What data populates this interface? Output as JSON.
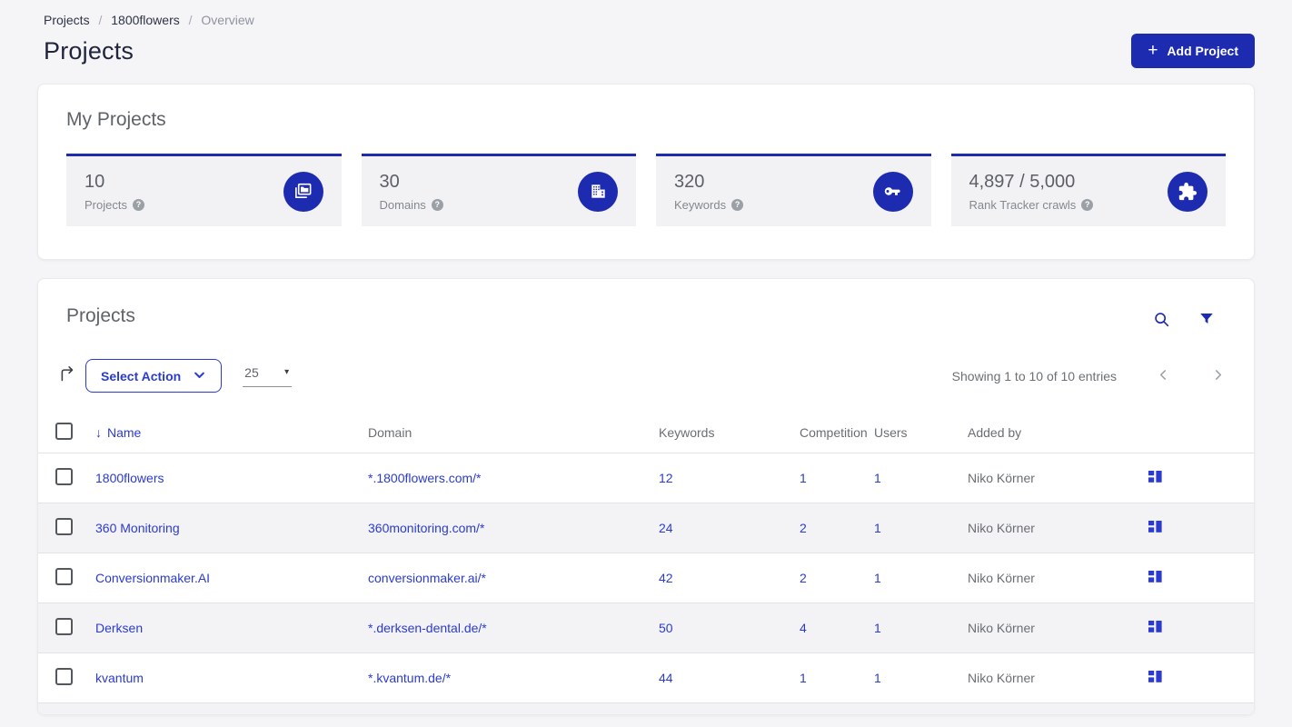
{
  "colors": {
    "primary": "#1d2bb1",
    "link": "#2b3bd0",
    "page_background": "#f5f5f7",
    "stripe": "#f3f3f5",
    "stat_background": "#f2f2f4"
  },
  "icons": {
    "help": "?",
    "plus": "+",
    "sort_desc": "↓",
    "caret": "▾"
  },
  "breadcrumb": {
    "separator": "/",
    "items": [
      "Projects",
      "1800flowers",
      "Overview"
    ]
  },
  "page": {
    "title": "Projects",
    "add_project_label": "Add Project"
  },
  "my_projects": {
    "title": "My Projects",
    "stats": [
      {
        "value": "10",
        "label": "Projects",
        "icon": "stacked-folders-icon"
      },
      {
        "value": "30",
        "label": "Domains",
        "icon": "building-icon"
      },
      {
        "value": "320",
        "label": "Keywords",
        "icon": "key-icon"
      },
      {
        "value": "4,897 / 5,000",
        "label": "Rank Tracker crawls",
        "icon": "puzzle-icon"
      }
    ]
  },
  "projects_table": {
    "title": "Projects",
    "select_action_label": "Select Action",
    "page_size": "25",
    "showing_text": "Showing 1 to 10 of 10 entries",
    "columns": {
      "name": "Name",
      "domain": "Domain",
      "keywords": "Keywords",
      "competition": "Competition",
      "users": "Users",
      "added_by": "Added by"
    },
    "rows": [
      {
        "name": "1800flowers",
        "domain": "*.1800flowers.com/*",
        "keywords": "12",
        "competition": "1",
        "users": "1",
        "added_by": "Niko Körner"
      },
      {
        "name": "360 Monitoring",
        "domain": "360monitoring.com/*",
        "keywords": "24",
        "competition": "2",
        "users": "1",
        "added_by": "Niko Körner"
      },
      {
        "name": "Conversionmaker.AI",
        "domain": "conversionmaker.ai/*",
        "keywords": "42",
        "competition": "2",
        "users": "1",
        "added_by": "Niko Körner"
      },
      {
        "name": "Derksen",
        "domain": "*.derksen-dental.de/*",
        "keywords": "50",
        "competition": "4",
        "users": "1",
        "added_by": "Niko Körner"
      },
      {
        "name": "kvantum",
        "domain": "*.kvantum.de/*",
        "keywords": "44",
        "competition": "1",
        "users": "1",
        "added_by": "Niko Körner"
      }
    ]
  }
}
